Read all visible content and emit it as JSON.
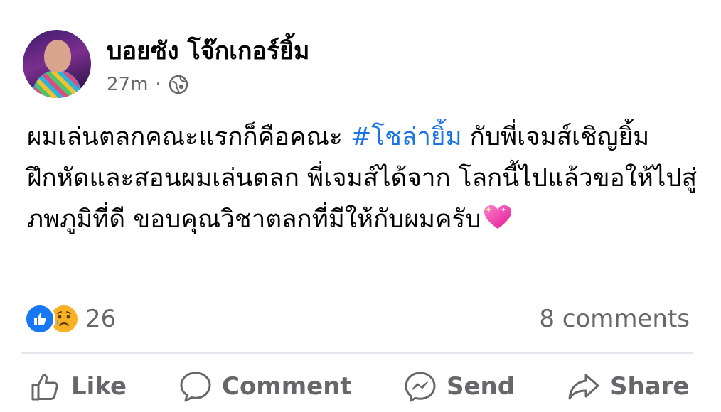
{
  "post": {
    "author_name": "บอยซัง โจ๊กเกอร์ยิ้ม",
    "timestamp": "27m",
    "separator": "·",
    "audience_icon": "globe-icon",
    "text_before_hashtag": "ผมเล่นตลกคณะแรกก็คือคณะ ",
    "hashtag": "#โชล่ายิ้ม",
    "text_after_hashtag": " กับพี่เจมส์เชิญยิ้ม ฝึกหัดและสอนผมเล่นตลก พี่เจมส์ได้จาก โลกนี้ไปแล้วขอให้ไปสู่ภพภูมิที่ดี ขอบคุณวิชาตลกที่มีให้กับผมครับ",
    "emoji": "sparkling-heart-icon"
  },
  "engagement": {
    "reaction_icons": [
      "like-reaction-icon",
      "sad-reaction-icon"
    ],
    "reaction_count": "26",
    "comments": "8 comments"
  },
  "actions": {
    "like": "Like",
    "comment": "Comment",
    "send": "Send",
    "share": "Share"
  },
  "colors": {
    "hashtag": "#1b74e4",
    "secondary_text": "#65676b",
    "like_blue": "#1877f2",
    "divider": "#e4e6eb"
  }
}
